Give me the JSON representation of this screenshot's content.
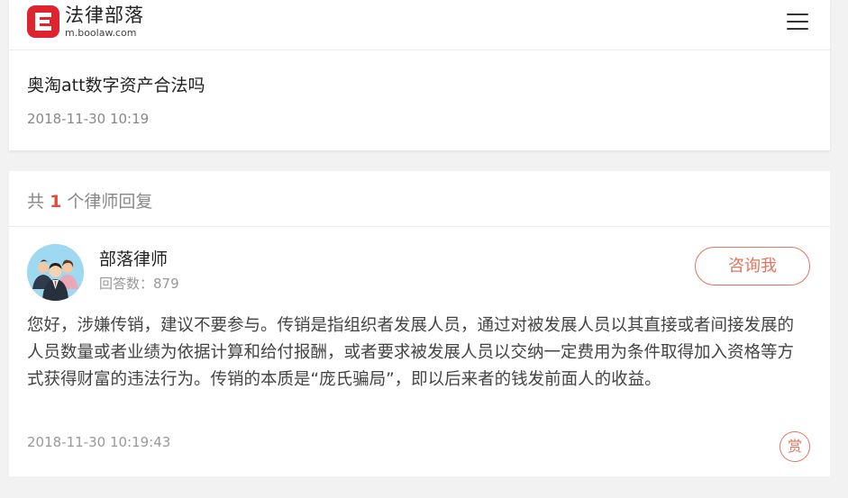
{
  "header": {
    "logo_name": "法律部落",
    "logo_domain": "m.boolaw.com",
    "menu_icon": "hamburger-menu-icon"
  },
  "question": {
    "title": "奥淘att数字资产合法吗",
    "date": "2018-11-30 10:19"
  },
  "replies": {
    "prefix": "共",
    "count": "1",
    "suffix": "个律师回复"
  },
  "answer": {
    "lawyer_name": "部落律师",
    "answer_count": "回答数：879",
    "consult_label": "咨询我",
    "body": "您好，涉嫌传销，建议不要参与。传销是指组织者发展人员，通过对被发展人员以其直接或者间接发展的人员数量或者业绩为依据计算和给付报酬，或者要求被发展人员以交纳一定费用为条件取得加入资格等方式获得财富的违法行为。传销的本质是“庞氏骗局”，即以后来者的钱发前面人的收益。",
    "date": "2018-11-30 10:19:43",
    "reward_label": "赏"
  },
  "colors": {
    "brand_red": "#e0242f",
    "accent_orange": "#e2745e",
    "count_red": "#e04a3a"
  }
}
